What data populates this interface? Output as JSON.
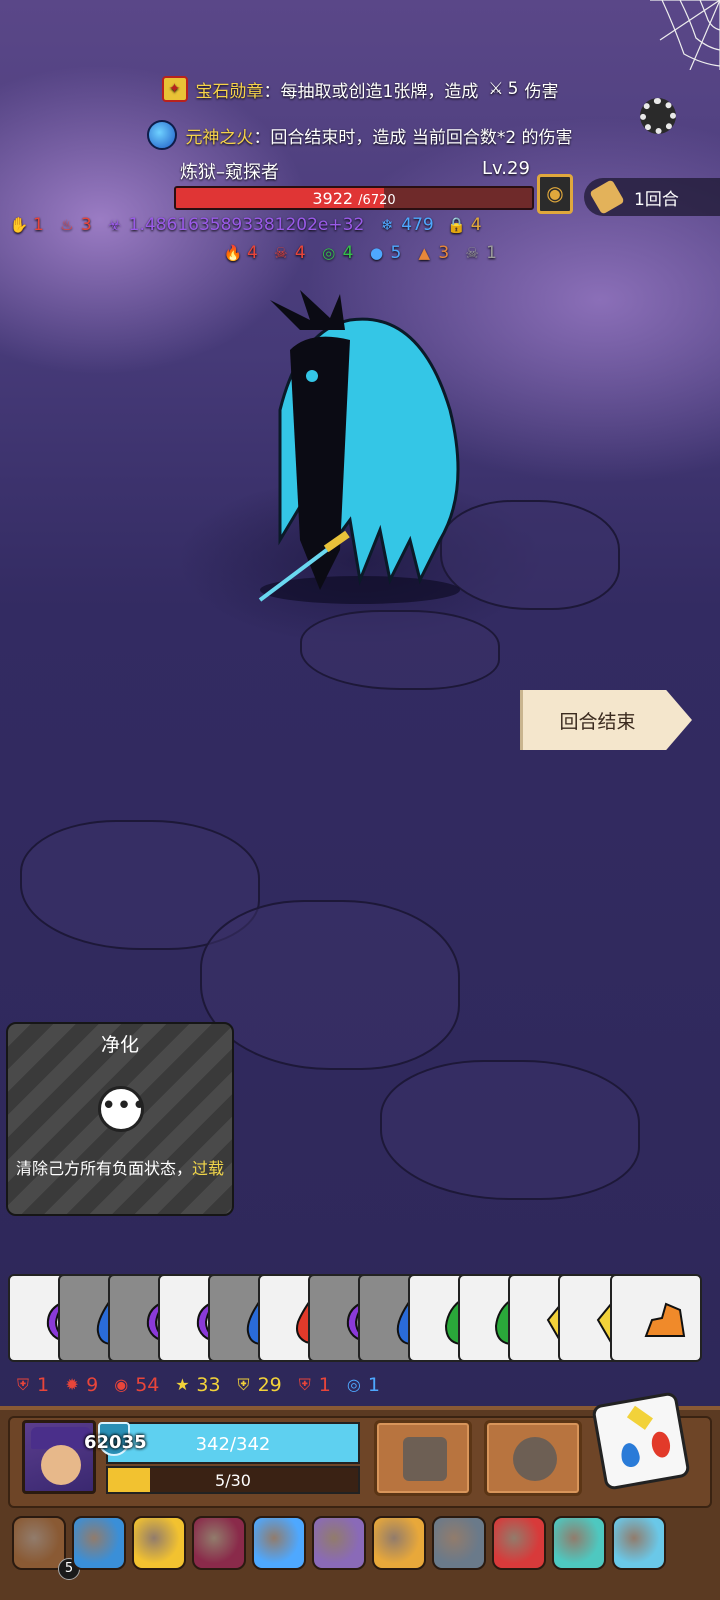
{
  "banner": {
    "gem_medal": {
      "name": "宝石勋章",
      "desc": "：每抽取或创造1张牌，造成",
      "damage": "5",
      "suffix": "伤害"
    },
    "spirit_fire": {
      "name": "元神之火",
      "desc": "：回合结束时，造成 当前回合数*2 的伤害"
    }
  },
  "boss": {
    "name": "炼狱–窥探者",
    "level": "Lv.29",
    "hp_current": "3922",
    "hp_max": "/6720",
    "hp_fraction": 0.583
  },
  "turn": {
    "label": "1回合"
  },
  "boss_status": {
    "row1": [
      {
        "icon": "claw-icon",
        "color": "#e8453a",
        "value": "1"
      },
      {
        "icon": "flame-icon",
        "color": "#e8453a",
        "value": "3"
      },
      {
        "icon": "poison-icon",
        "color": "#9a5ae8",
        "value": "1.4861635893381202e+32"
      },
      {
        "icon": "snowflake-icon",
        "color": "#4ea8ff",
        "value": "479"
      },
      {
        "icon": "lock-icon",
        "color": "#e0a83c",
        "value": "4"
      }
    ],
    "row2": [
      {
        "icon": "fire-icon",
        "color": "#e8453a",
        "value": "4"
      },
      {
        "icon": "demon-icon",
        "color": "#e8453a",
        "value": "4"
      },
      {
        "icon": "vortex-icon",
        "color": "#35c04a",
        "value": "4"
      },
      {
        "icon": "speech-icon",
        "color": "#4ea8ff",
        "value": "5"
      },
      {
        "icon": "burn-icon",
        "color": "#e8873a",
        "value": "3"
      },
      {
        "icon": "skull-icon",
        "color": "#9a9a9a",
        "value": "1"
      }
    ]
  },
  "end_turn_button": "回合结束",
  "skill_card": {
    "title": "净化",
    "desc_main": "清除己方所有负面状态，",
    "desc_highlight": "过载"
  },
  "hand_cards": [
    {
      "bg": "white",
      "shape": "moon",
      "color": "#8a3ad8"
    },
    {
      "bg": "grey",
      "shape": "drop",
      "color": "#2a6bd8"
    },
    {
      "bg": "grey",
      "shape": "moon",
      "color": "#8a3ad8"
    },
    {
      "bg": "white",
      "shape": "moon",
      "color": "#8a3ad8"
    },
    {
      "bg": "grey",
      "shape": "drop",
      "color": "#2a6bd8"
    },
    {
      "bg": "white",
      "shape": "fire",
      "color": "#e23a2a"
    },
    {
      "bg": "grey",
      "shape": "moon",
      "color": "#8a3ad8"
    },
    {
      "bg": "grey",
      "shape": "drop",
      "color": "#2a6bd8"
    },
    {
      "bg": "white",
      "shape": "leaf",
      "color": "#2aa83a"
    },
    {
      "bg": "white",
      "shape": "leaf",
      "color": "#2aa83a"
    },
    {
      "bg": "white",
      "shape": "diamond",
      "color": "#f2d23a"
    },
    {
      "bg": "white",
      "shape": "diamond",
      "color": "#f2d23a"
    },
    {
      "bg": "white",
      "shape": "rock",
      "color": "#f08a2a"
    }
  ],
  "player_buffs": [
    {
      "icon": "shield-heart-icon",
      "color": "#e8453a",
      "value": "1"
    },
    {
      "icon": "gear-burst-icon",
      "color": "#e8453a",
      "value": "9"
    },
    {
      "icon": "ring-shield-icon",
      "color": "#e8453a",
      "value": "54"
    },
    {
      "icon": "star-icon",
      "color": "#f2d23a",
      "value": "33"
    },
    {
      "icon": "gold-shield-icon",
      "color": "#f2d23a",
      "value": "29"
    },
    {
      "icon": "red-shield-icon",
      "color": "#e8453a",
      "value": "1"
    },
    {
      "icon": "blue-target-icon",
      "color": "#4ea8ff",
      "value": "1"
    }
  ],
  "player": {
    "shield": "62035",
    "hp": "342/342",
    "hp_fraction": 1.0,
    "exp": "5/30",
    "exp_fraction": 0.1667
  },
  "relics": [
    {
      "icon": "wood-shield-relic-icon",
      "color": "#8a5a34",
      "badge": "5"
    },
    {
      "icon": "blue-cloud-relic-icon",
      "color": "#3a8fd8"
    },
    {
      "icon": "gold-ring-relic-icon",
      "color": "#f2c230"
    },
    {
      "icon": "armor-relic-icon",
      "color": "#8a2a4a"
    },
    {
      "icon": "crystal-relic-icon",
      "color": "#4ea8ff"
    },
    {
      "icon": "purple-stone-relic-icon",
      "color": "#8a6ab8"
    },
    {
      "icon": "spellbook-relic-icon",
      "color": "#e8a83a"
    },
    {
      "icon": "cube-relic-icon",
      "color": "#6a7a8a"
    },
    {
      "icon": "bracelet-relic-icon",
      "color": "#d83a3a"
    },
    {
      "icon": "axe-relic-icon",
      "color": "#4ec8c0"
    },
    {
      "icon": "dagger-relic-icon",
      "color": "#6ac8e8"
    }
  ]
}
